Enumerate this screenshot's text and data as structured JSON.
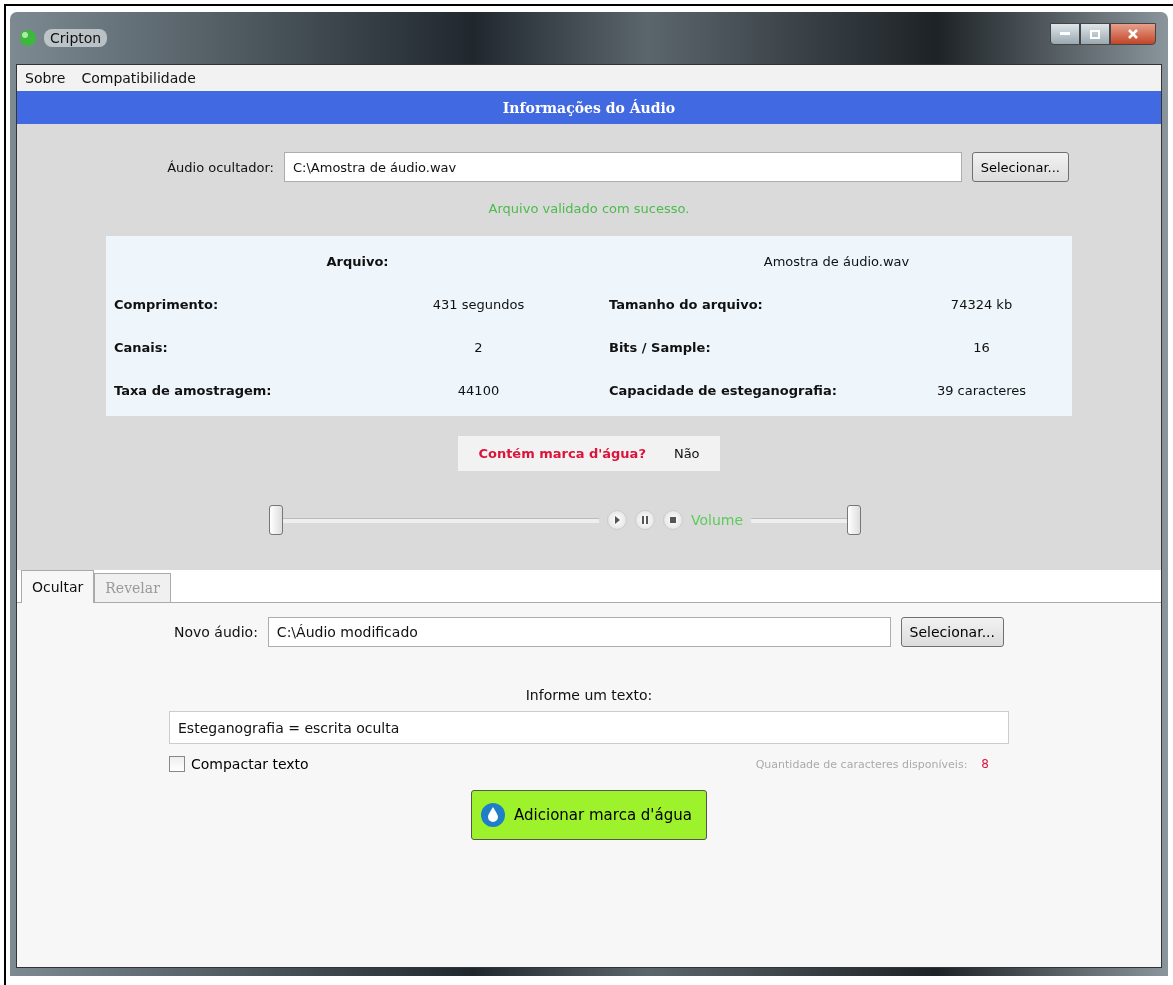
{
  "window": {
    "title": "Cripton"
  },
  "menu": [
    "Sobre",
    "Compatibilidade"
  ],
  "header": "Informações do Áudio",
  "source": {
    "label": "Áudio ocultador:",
    "value": "C:\\Amostra de áudio.wav",
    "button": "Selecionar..."
  },
  "status": "Arquivo validado com sucesso.",
  "file": {
    "label": "Arquivo:",
    "value": "Amostra de áudio.wav"
  },
  "info": [
    {
      "label": "Comprimento:",
      "value": "431 segundos",
      "label2": "Tamanho do arquivo:",
      "value2": "74324 kb"
    },
    {
      "label": "Canais:",
      "value": "2",
      "label2": "Bits / Sample:",
      "value2": "16"
    },
    {
      "label": "Taxa de amostragem:",
      "value": "44100",
      "label2": "Capacidade de esteganografia:",
      "value2": "39 caracteres"
    }
  ],
  "watermark": {
    "label": "Contém marca d'água?",
    "value": "Não"
  },
  "player": {
    "position": {
      "level": 0
    },
    "volume_label": "Volume",
    "volume": {
      "level": 1
    }
  },
  "tabs": [
    {
      "label": "Ocultar",
      "selected": true
    },
    {
      "label": "Revelar",
      "selected": false
    }
  ],
  "output": {
    "label": "Novo áudio:",
    "value": "C:\\Áudio modificado",
    "button": "Selecionar..."
  },
  "text_label": "Informe um texto:",
  "text_value": "Esteganografia = escrita oculta",
  "compact": {
    "label": "Compactar texto",
    "checked": false
  },
  "available": {
    "label": "Quantidade de caracteres disponíveis:",
    "value": "8"
  },
  "action": "Adicionar marca d'água"
}
